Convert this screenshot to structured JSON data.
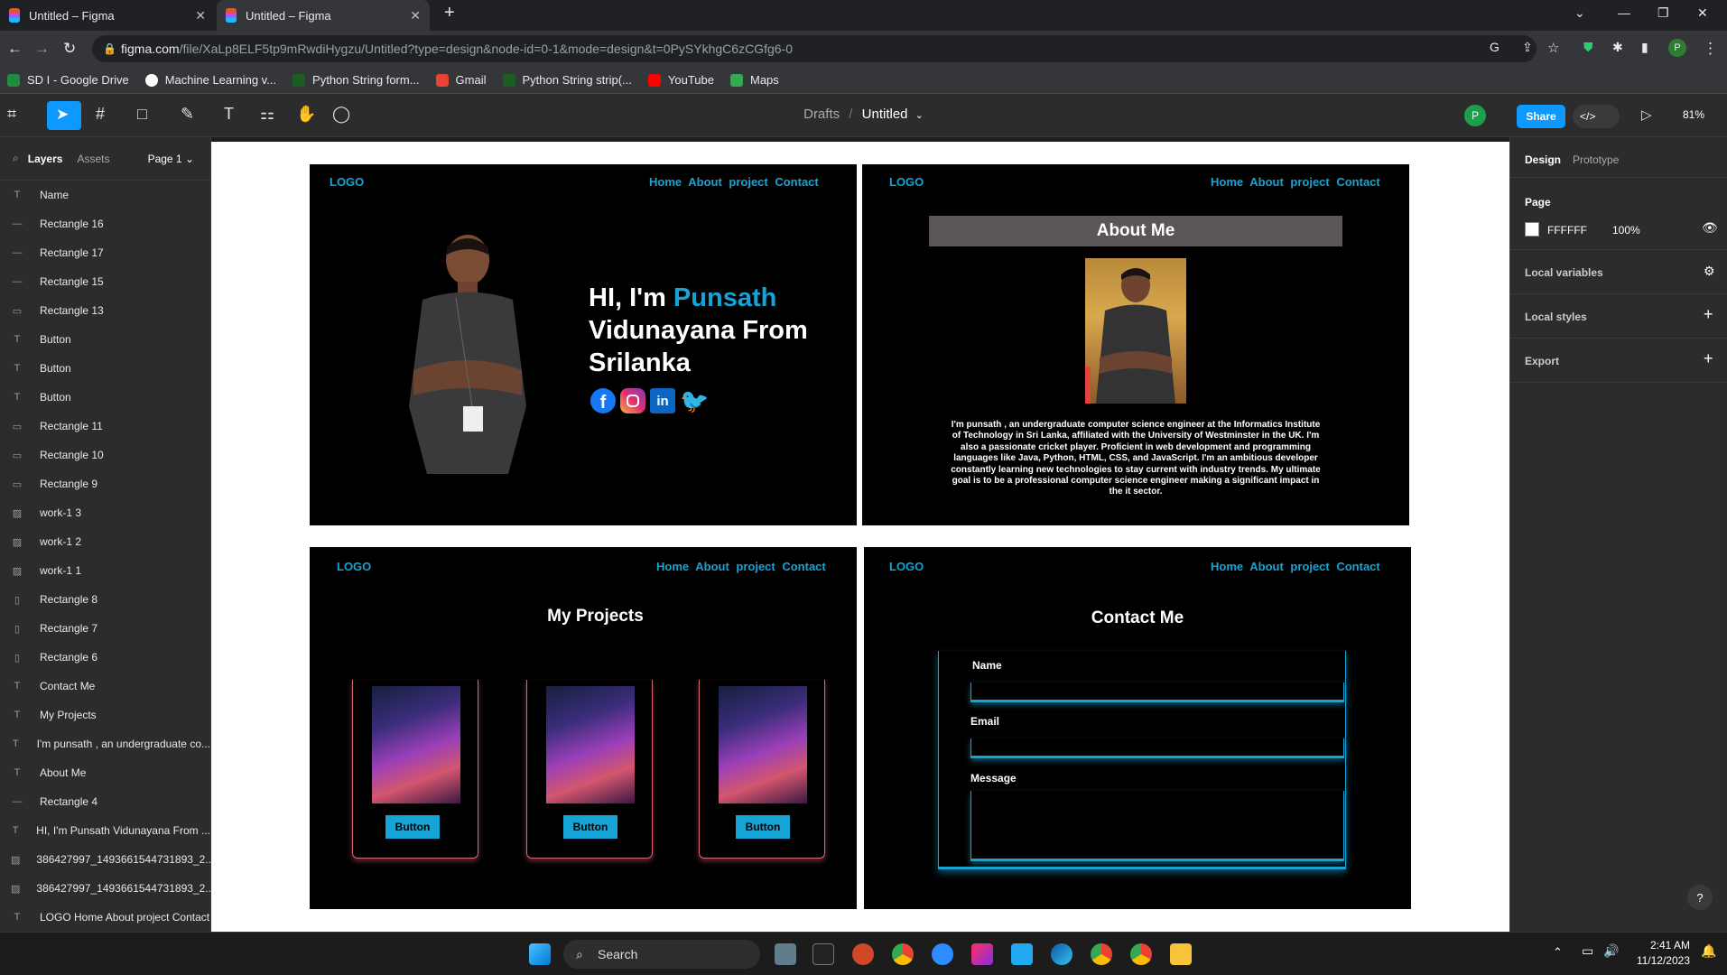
{
  "browser": {
    "tabs": [
      {
        "title": "Untitled – Figma"
      },
      {
        "title": "Untitled – Figma"
      }
    ],
    "url_host": "figma.com",
    "url_path": "/file/XaLp8ELF5tp9mRwdiHygzu/Untitled?type=design&node-id=0-1&mode=design&t=0PySYkhgC6zCGfg6-0",
    "bookmarks": [
      "SD I - Google Drive",
      "Machine Learning v...",
      "Python String form...",
      "Gmail",
      "Python String strip(...",
      "YouTube",
      "Maps"
    ],
    "profile": "P"
  },
  "toolbar": {
    "breadcrumb": "Drafts",
    "separator": "/",
    "file": "Untitled",
    "share": "Share",
    "zoom": "81%",
    "user": "P"
  },
  "left_panel": {
    "tab_layers": "Layers",
    "tab_assets": "Assets",
    "page": "Page 1",
    "layers": [
      {
        "icon": "T",
        "name": "Name"
      },
      {
        "icon": "—",
        "name": "Rectangle 16"
      },
      {
        "icon": "—",
        "name": "Rectangle 17"
      },
      {
        "icon": "—",
        "name": "Rectangle 15"
      },
      {
        "icon": "▭",
        "name": "Rectangle 13"
      },
      {
        "icon": "T",
        "name": "Button"
      },
      {
        "icon": "T",
        "name": "Button"
      },
      {
        "icon": "T",
        "name": "Button"
      },
      {
        "icon": "▭",
        "name": "Rectangle 11"
      },
      {
        "icon": "▭",
        "name": "Rectangle 10"
      },
      {
        "icon": "▭",
        "name": "Rectangle 9"
      },
      {
        "icon": "▨",
        "name": "work-1 3"
      },
      {
        "icon": "▨",
        "name": "work-1 2"
      },
      {
        "icon": "▨",
        "name": "work-1 1"
      },
      {
        "icon": "▯",
        "name": "Rectangle 8"
      },
      {
        "icon": "▯",
        "name": "Rectangle 7"
      },
      {
        "icon": "▯",
        "name": "Rectangle 6"
      },
      {
        "icon": "T",
        "name": "Contact Me"
      },
      {
        "icon": "T",
        "name": "My Projects"
      },
      {
        "icon": "T",
        "name": "I'm punsath , an undergraduate co..."
      },
      {
        "icon": "T",
        "name": "About Me"
      },
      {
        "icon": "—",
        "name": "Rectangle 4"
      },
      {
        "icon": "T",
        "name": "HI, I'm Punsath Vidunayana From ..."
      },
      {
        "icon": "▨",
        "name": "386427997_1493661544731893_2..."
      },
      {
        "icon": "▨",
        "name": "386427997_1493661544731893_2..."
      },
      {
        "icon": "T",
        "name": "LOGO Home About project Contact"
      }
    ]
  },
  "right_panel": {
    "tab_design": "Design",
    "tab_prototype": "Prototype",
    "page_label": "Page",
    "page_color": "FFFFFF",
    "page_opacity": "100%",
    "local_variables": "Local variables",
    "local_styles": "Local styles",
    "export": "Export"
  },
  "design": {
    "logo": "LOGO",
    "nav": "Home  About  project Contact",
    "hero_line1_a": "HI, I'm ",
    "hero_line1_b": "Punsath",
    "hero_line2": "Vidunayana From",
    "hero_line3": "Srilanka",
    "about_title": "About Me",
    "about_text": "I'm punsath  , an undergraduate computer science engineer at the Informatics Institute of Technology in Sri Lanka, affiliated with the University of Westminster in the UK. I'm also a passionate cricket player. Proficient in web development and programming languages like Java, Python, HTML, CSS, and JavaScript. I'm an ambitious developer constantly learning new technologies to stay current with industry trends. My ultimate goal is to be a professional computer science engineer making a significant impact in the it sector.",
    "projects_title": "My Projects",
    "button": "Button",
    "contact_title": "Contact Me",
    "field_name": "Name",
    "field_email": "Email",
    "field_message": "Message"
  },
  "taskbar": {
    "search": "Search",
    "time": "2:41 AM",
    "date": "11/12/2023"
  },
  "help": "?"
}
